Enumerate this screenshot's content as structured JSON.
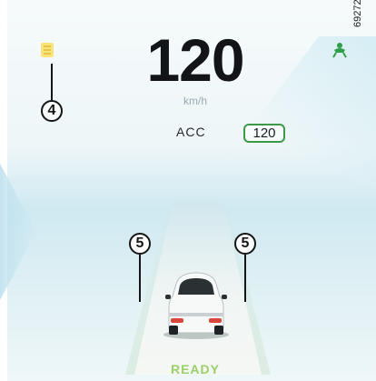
{
  "speed": {
    "value": "120",
    "unit": "km/h"
  },
  "acc": {
    "label": "ACC",
    "set_speed": "120"
  },
  "status": {
    "ready_text": "READY"
  },
  "figure_number": "69272",
  "callouts": {
    "warning_lamp": "4",
    "lane_left": "5",
    "lane_right": "5"
  },
  "icons": {
    "warning_lamp": "adaptive-cruise-warning-icon",
    "driver_assist": "driver-assist-icon",
    "vehicle": "vehicle-icon"
  },
  "colors": {
    "acc_border": "#3a9a46",
    "ready_text": "#9ad06a",
    "warning_lamp": "#f2d34a",
    "driver_assist": "#2f9f48",
    "speed_text": "#121417"
  }
}
